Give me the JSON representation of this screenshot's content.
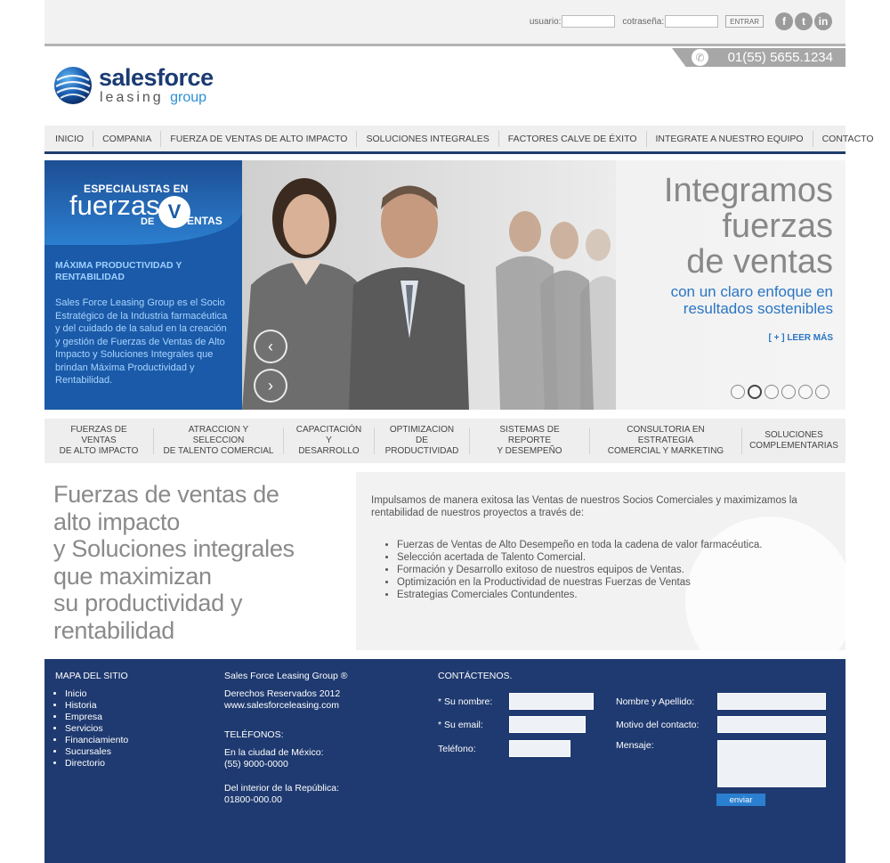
{
  "login": {
    "user_label": "usuario:",
    "pass_label": "cotraseña:",
    "enter_label": "ENTRAR"
  },
  "social": [
    {
      "icon": "facebook-icon",
      "glyph": "f"
    },
    {
      "icon": "twitter-icon",
      "glyph": "t"
    },
    {
      "icon": "linkedin-icon",
      "glyph": "in"
    }
  ],
  "phone": {
    "number": "01(55) 5655.1234"
  },
  "logo": {
    "word1": "salesforce",
    "word2": "leasing",
    "word3": "group"
  },
  "nav": [
    "INICIO",
    "COMPANIA",
    "FUERZA DE VENTAS DE ALTO IMPACTO",
    "SOLUCIONES INTEGRALES",
    "FACTORES CALVE DE ÉXITO",
    "INTEGRATE A NUESTRO EQUIPO",
    "CONTACTO"
  ],
  "hero": {
    "badge_top": "ESPECIALISTAS EN",
    "badge_main": "fuerzas",
    "badge_de": "DE",
    "badge_ventas": "ENTAS",
    "subtitle": "MÁXIMA PRODUCTIVIDAD Y RENTABILIDAD",
    "body": "Sales Force Leasing Group es el Socio Estratégico de la Industria farmacéutica y del cuidado de la salud en la creación y gestión de Fuerzas de Ventas de Alto Impacto y Soluciones Integrales que brindan Máxima Productividad y Rentabilidad.",
    "line1": "Integramos",
    "line2": "fuerzas",
    "line3": "de ventas",
    "sub1": "con un claro enfoque en",
    "sub2": "resultados sostenibles",
    "more": "[ + ] LEER MÁS",
    "slides": 6,
    "active_slide": 2
  },
  "services": [
    [
      "FUERZAS DE VENTAS",
      "DE ALTO IMPACTO"
    ],
    [
      "ATRACCION Y SELECCION",
      "DE TALENTO COMERCIAL"
    ],
    [
      "CAPACITACIÓN Y",
      "DESARROLLO"
    ],
    [
      "OPTIMIZACION DE",
      "PRODUCTIVIDAD"
    ],
    [
      "SISTEMAS DE REPORTE",
      "Y DESEMPEÑO"
    ],
    [
      "CONSULTORIA EN ESTRATEGIA",
      "COMERCIAL Y MARKETING"
    ],
    [
      "SOLUCIONES",
      "COMPLEMENTARIAS"
    ]
  ],
  "headline": [
    "Fuerzas de ventas de",
    "alto impacto",
    "y Soluciones integrales",
    "que maximizan",
    "su productividad y",
    "rentabilidad"
  ],
  "info": {
    "intro": "Impulsamos de manera exitosa las Ventas de nuestros Socios Comerciales y maximizamos la rentabilidad de nuestros proyectos a través de:",
    "items": [
      "Fuerzas de Ventas de Alto Desempeño en toda la cadena de valor farmacéutica.",
      "Selección acertada de Talento Comercial.",
      "Formación y Desarrollo exitoso de nuestros equipos de Ventas.",
      "Optimización en la Productividad de nuestras Fuerzas de Ventas",
      "Estrategias Comerciales Contundentes."
    ]
  },
  "footer": {
    "sitemap_title": "MAPA DEL SITIO",
    "sitemap": [
      "Inicio",
      "Historia",
      "Empresa",
      "Servicios",
      "Financiamiento",
      "Sucursales",
      "Directorio"
    ],
    "company": "Sales Force Leasing Group ®",
    "rights": "Derechos Reservados 2012",
    "website": "www.salesforceleasing.com",
    "phones_title": "TELÉFONOS:",
    "city_label": "En la ciudad de México:",
    "city_phone": "(55) 9000-0000",
    "country_label": "Del interior de la República:",
    "country_phone": "01800-000.00",
    "contact_title": "CONTÁCTENOS.",
    "name_label": "* Su nombre:",
    "email_label": "* Su email:",
    "tel_label": "Teléfono:",
    "fullname_label": "Nombre y Apellido:",
    "reason_label": "Motivo del contacto:",
    "message_label": "Mensaje:",
    "send_label": "enviar"
  }
}
